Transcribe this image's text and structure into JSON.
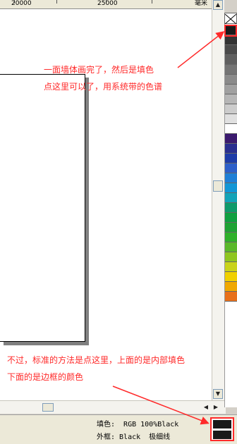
{
  "ruler": {
    "labels": [
      "20000",
      "25000",
      "毫米"
    ]
  },
  "annotations": {
    "top_line1": "一面墙体画完了，然后是填色",
    "top_line2": "点这里可以了，用系统带的色谱",
    "bottom_line1": "不过，标准的方法是点这里，上面的是内部填色",
    "bottom_line2": "下面的是边框的颜色"
  },
  "status": {
    "fill_line": "填色:  RGB 100%Black",
    "outline_line": "外框: Black  极细线"
  },
  "palette": {
    "colors": [
      "#1a1a1a",
      "#333333",
      "#4a4a4a",
      "#5f5f5f",
      "#747474",
      "#8a8a8a",
      "#a0a0a0",
      "#b6b6b6",
      "#cccccc",
      "#e0e0e0",
      "#ffffff",
      "#3b1a6e",
      "#2a2f8f",
      "#1e3ca8",
      "#2d5fc9",
      "#1f7fd6",
      "#1296d6",
      "#13a3b8",
      "#0f9a6a",
      "#10a040",
      "#1fa234",
      "#2fb02a",
      "#5ab82a",
      "#8fc620",
      "#c9d31a",
      "#f0d000",
      "#f0a800",
      "#e8701a"
    ]
  },
  "colors": {
    "annotation": "#ff2a2a",
    "fill": "#1a1a1a"
  }
}
